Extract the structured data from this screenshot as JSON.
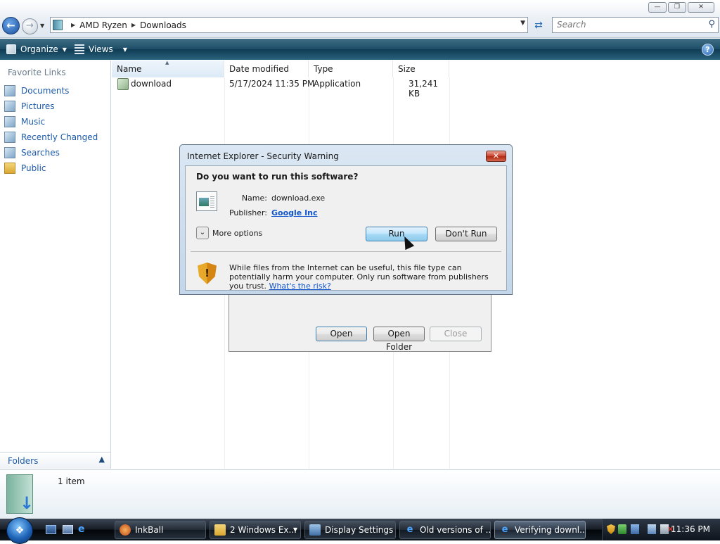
{
  "address": {
    "breadcrumbs": [
      "AMD Ryzen",
      "Downloads"
    ],
    "search_placeholder": "Search"
  },
  "window_controls": {
    "minimize_icon": "minimize-icon",
    "maximize_icon": "maximize-icon",
    "close_icon": "close-icon"
  },
  "toolbar": {
    "organize_label": "Organize",
    "views_label": "Views"
  },
  "navpane": {
    "header": "Favorite Links",
    "items": [
      {
        "label": "Documents",
        "icon": "documents-icon"
      },
      {
        "label": "Pictures",
        "icon": "pictures-icon"
      },
      {
        "label": "Music",
        "icon": "music-icon"
      },
      {
        "label": "Recently Changed",
        "icon": "recent-icon"
      },
      {
        "label": "Searches",
        "icon": "searches-icon"
      },
      {
        "label": "Public",
        "icon": "public-folder-icon"
      }
    ],
    "folders_label": "Folders"
  },
  "filelist": {
    "columns": [
      "Name",
      "Date modified",
      "Type",
      "Size"
    ],
    "rows": [
      {
        "name": "download",
        "date": "5/17/2024 11:35 PM",
        "type": "Application",
        "size": "31,241 KB"
      }
    ]
  },
  "download_window": {
    "open_label": "Open",
    "open_folder_label": "Open Folder",
    "close_label": "Close"
  },
  "security_dialog": {
    "title": "Internet Explorer - Security Warning",
    "question": "Do you want to run this software?",
    "name_label": "Name:",
    "name_value": "download.exe",
    "publisher_label": "Publisher:",
    "publisher_value": "Google Inc",
    "more_options": "More options",
    "run_label": "Run",
    "dont_run_label": "Don't Run",
    "warning_text": "While files from the Internet can be useful, this file type can potentially harm your computer. Only run software from publishers you trust.",
    "risk_link": "What's the risk?"
  },
  "details": {
    "item_count": "1 item"
  },
  "taskbar": {
    "buttons": [
      {
        "label": "InkBall",
        "icon": "inkball-icon"
      },
      {
        "label": "2 Windows Ex...",
        "icon": "folder-icon"
      },
      {
        "label": "Display Settings",
        "icon": "display-settings-icon"
      },
      {
        "label": "Old versions of ...",
        "icon": "ie-icon"
      },
      {
        "label": "Verifying downl...",
        "icon": "ie-icon"
      }
    ],
    "clock": "11:36 PM"
  }
}
